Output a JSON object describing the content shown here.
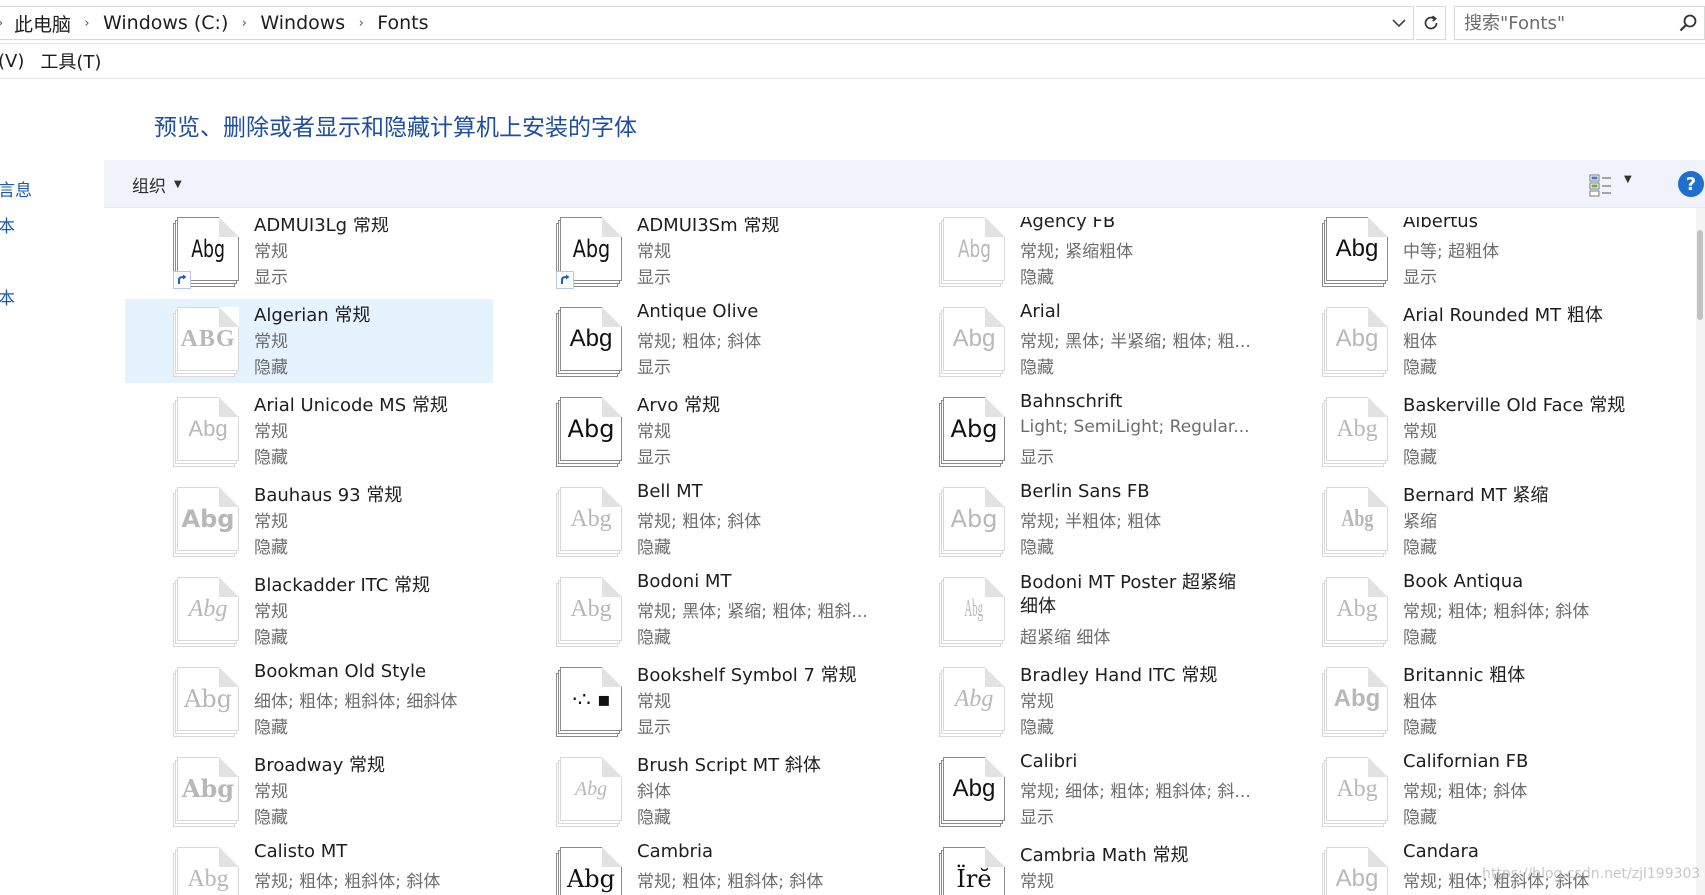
{
  "address": {
    "crumbs": [
      "此电脑",
      "Windows (C:)",
      "Windows",
      "Fonts"
    ]
  },
  "search": {
    "placeholder": "搜索\"Fonts\""
  },
  "menu": {
    "items": [
      "(V)",
      "工具(T)"
    ]
  },
  "left_pane": {
    "items": [
      "言息",
      "本",
      "本"
    ]
  },
  "heading": "预览、删除或者显示和隐藏计算机上安装的字体",
  "toolbar": {
    "organize": "组织",
    "help": "?"
  },
  "fonts": [
    {
      "name": "ADMUI3Lg 常规",
      "styles": "常规",
      "state": "显示",
      "sample": "Abg",
      "active": true,
      "shortcut": true
    },
    {
      "name": "ADMUI3Sm 常规",
      "styles": "常规",
      "state": "显示",
      "sample": "Abg",
      "active": true,
      "shortcut": true
    },
    {
      "name": "Agency FB",
      "styles": "常规; 紧缩粗体",
      "state": "隐藏",
      "sample": "Abg",
      "active": false
    },
    {
      "name": "Albertus",
      "styles": "中等; 超粗体",
      "state": "显示",
      "sample": "Abg",
      "active": true
    },
    {
      "name": "Algerian 常规",
      "styles": "常规",
      "state": "隐藏",
      "sample": "ABG",
      "active": false,
      "selected": true
    },
    {
      "name": "Antique Olive",
      "styles": "常规; 粗体; 斜体",
      "state": "显示",
      "sample": "Abg",
      "active": true
    },
    {
      "name": "Arial",
      "styles": "常规; 黑体; 半紧缩; 粗体; 粗...",
      "state": "隐藏",
      "sample": "Abg",
      "active": false
    },
    {
      "name": "Arial Rounded MT 粗体",
      "styles": "粗体",
      "state": "隐藏",
      "sample": "Abg",
      "active": false
    },
    {
      "name": "Arial Unicode MS 常规",
      "styles": "常规",
      "state": "隐藏",
      "sample": "Abg",
      "active": false
    },
    {
      "name": "Arvo 常规",
      "styles": "常规",
      "state": "显示",
      "sample": "Abg",
      "active": true
    },
    {
      "name": "Bahnschrift",
      "styles": "Light; SemiLight; Regular...",
      "state": "显示",
      "sample": "Abg",
      "active": true
    },
    {
      "name": "Baskerville Old Face 常规",
      "styles": "常规",
      "state": "隐藏",
      "sample": "Abg",
      "active": false
    },
    {
      "name": "Bauhaus 93 常规",
      "styles": "常规",
      "state": "隐藏",
      "sample": "Abg",
      "active": false
    },
    {
      "name": "Bell MT",
      "styles": "常规; 粗体; 斜体",
      "state": "隐藏",
      "sample": "Abg",
      "active": false
    },
    {
      "name": "Berlin Sans FB",
      "styles": "常规; 半粗体; 粗体",
      "state": "隐藏",
      "sample": "Abg",
      "active": false
    },
    {
      "name": "Bernard MT 紧缩",
      "styles": "紧缩",
      "state": "隐藏",
      "sample": "Abg",
      "active": false
    },
    {
      "name": "Blackadder ITC 常规",
      "styles": "常规",
      "state": "隐藏",
      "sample": "Abg",
      "active": false
    },
    {
      "name": "Bodoni MT",
      "styles": "常规; 黑体; 紧缩; 粗体; 粗斜...",
      "state": "隐藏",
      "sample": "Abg",
      "active": false
    },
    {
      "name": "Bodoni MT Poster 超紧缩 细体",
      "styles": "超紧缩 细体",
      "state": "",
      "sample": "Abg",
      "active": false,
      "wrap": true
    },
    {
      "name": "Book Antiqua",
      "styles": "常规; 粗体; 粗斜体; 斜体",
      "state": "隐藏",
      "sample": "Abg",
      "active": false
    },
    {
      "name": "Bookman Old Style",
      "styles": "细体; 粗体; 粗斜体; 细斜体",
      "state": "隐藏",
      "sample": "Abg",
      "active": false
    },
    {
      "name": "Bookshelf Symbol 7 常规",
      "styles": "常规",
      "state": "显示",
      "sample": "·∴ ▪",
      "active": true
    },
    {
      "name": "Bradley Hand ITC 常规",
      "styles": "常规",
      "state": "隐藏",
      "sample": "Abg",
      "active": false
    },
    {
      "name": "Britannic 粗体",
      "styles": "粗体",
      "state": "隐藏",
      "sample": "Abg",
      "active": false
    },
    {
      "name": "Broadway 常规",
      "styles": "常规",
      "state": "隐藏",
      "sample": "Abg",
      "active": false
    },
    {
      "name": "Brush Script MT 斜体",
      "styles": "斜体",
      "state": "隐藏",
      "sample": "Abg",
      "active": false
    },
    {
      "name": "Calibri",
      "styles": "常规; 细体; 粗体; 粗斜体; 斜...",
      "state": "显示",
      "sample": "Abg",
      "active": true
    },
    {
      "name": "Californian FB",
      "styles": "常规; 粗体; 斜体",
      "state": "隐藏",
      "sample": "Abg",
      "active": false
    },
    {
      "name": "Calisto MT",
      "styles": "常规; 粗体; 粗斜体; 斜体",
      "state": "",
      "sample": "Abg",
      "active": false
    },
    {
      "name": "Cambria",
      "styles": "常规; 粗体; 粗斜体; 斜体",
      "state": "",
      "sample": "Abg",
      "active": true
    },
    {
      "name": "Cambria Math 常规",
      "styles": "常规",
      "state": "",
      "sample": "Ïrĕ",
      "active": true
    },
    {
      "name": "Candara",
      "styles": "常规; 粗体; 粗斜体; 斜体",
      "state": "",
      "sample": "Abg",
      "active": false
    }
  ],
  "watermark": "https://blog.csdn.net/zjl199303",
  "colors": {
    "heading": "#1f4e9c",
    "selection": "#e5f3ff",
    "help": "#1f6fd1",
    "secondary_text": "#6d6d6d"
  }
}
